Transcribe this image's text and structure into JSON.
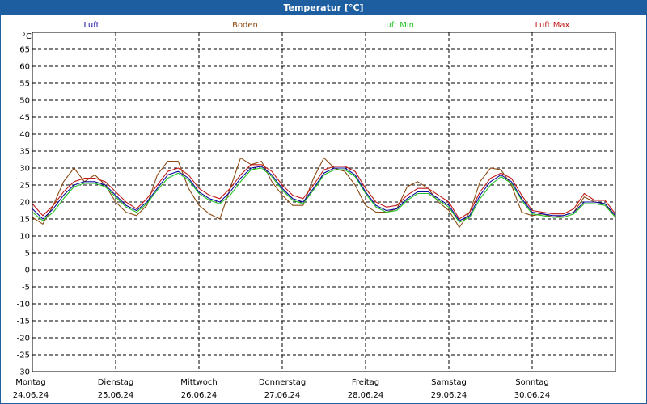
{
  "window": {
    "title": "Temperatur [°C]"
  },
  "colors": {
    "luft": "#0a0aa0",
    "boden": "#8a4a12",
    "luft_min": "#22c022",
    "luft_max": "#c01818"
  },
  "chart_data": {
    "type": "line",
    "title": "Temperatur [°C]",
    "ylabel": "°C",
    "ylim": [
      -30,
      70
    ],
    "yticks": [
      -30,
      -25,
      -20,
      -15,
      -10,
      -5,
      0,
      5,
      10,
      15,
      20,
      25,
      30,
      35,
      40,
      45,
      50,
      55,
      60,
      65
    ],
    "grid": true,
    "legend_placement": "top",
    "x_range": [
      0,
      7
    ],
    "days": [
      {
        "weekday": "Montag",
        "date": "24.06.24"
      },
      {
        "weekday": "Dienstag",
        "date": "25.06.24"
      },
      {
        "weekday": "Mittwoch",
        "date": "26.06.24"
      },
      {
        "weekday": "Donnerstag",
        "date": "27.06.24"
      },
      {
        "weekday": "Freitag",
        "date": "28.06.24"
      },
      {
        "weekday": "Samstag",
        "date": "29.06.24"
      },
      {
        "weekday": "Sonntag",
        "date": "30.06.24"
      }
    ],
    "x": [
      0,
      0.125,
      0.25,
      0.375,
      0.5,
      0.625,
      0.75,
      0.875,
      1,
      1.125,
      1.25,
      1.375,
      1.5,
      1.625,
      1.75,
      1.875,
      2,
      2.125,
      2.25,
      2.375,
      2.5,
      2.625,
      2.75,
      2.875,
      3,
      3.125,
      3.25,
      3.375,
      3.5,
      3.625,
      3.75,
      3.875,
      4,
      4.125,
      4.25,
      4.375,
      4.5,
      4.625,
      4.75,
      4.875,
      5,
      5.125,
      5.25,
      5.375,
      5.5,
      5.625,
      5.75,
      5.875,
      6,
      6.125,
      6.25,
      6.375,
      6.5,
      6.625,
      6.75,
      6.875,
      7
    ],
    "series": [
      {
        "name": "Luft",
        "key": "luft",
        "values": [
          18,
          15,
          18,
          22,
          25,
          26,
          26,
          25,
          22,
          19,
          17.5,
          20,
          24,
          28,
          29,
          27,
          23,
          21,
          20,
          23,
          27,
          30,
          30.5,
          28,
          24,
          21,
          20,
          24,
          28.5,
          30,
          30,
          28,
          23,
          19,
          17.5,
          18,
          21,
          23,
          23,
          21,
          19,
          14.5,
          16,
          22,
          26,
          28,
          26,
          21,
          17,
          16.5,
          16,
          16,
          17,
          20,
          20,
          19.5,
          16
        ]
      },
      {
        "name": "Boden",
        "key": "boden",
        "values": [
          15.5,
          13.5,
          19,
          26,
          30,
          26,
          28,
          25,
          20,
          17,
          16,
          19,
          28,
          32,
          32,
          24,
          19,
          16.5,
          15,
          24,
          33,
          31,
          32,
          26,
          22,
          19,
          19,
          27,
          33,
          30,
          29,
          25,
          19,
          17,
          17,
          18,
          24.5,
          26,
          24,
          20,
          17.5,
          12.5,
          17,
          26,
          30,
          29.5,
          25,
          17,
          16,
          16.5,
          15.5,
          16,
          17,
          21.5,
          20,
          19.5,
          15.5
        ]
      },
      {
        "name": "Luft Min",
        "key": "luft_min",
        "values": [
          17,
          14.5,
          17,
          21,
          24.5,
          25.5,
          25.5,
          24.5,
          21.5,
          18.5,
          17,
          19.5,
          23.5,
          27,
          28.5,
          26.5,
          22.5,
          20.5,
          19.5,
          22,
          26,
          29.5,
          30,
          27.5,
          23.5,
          20.5,
          19.5,
          23.5,
          28,
          29.5,
          29.5,
          27.5,
          22.5,
          18.5,
          17,
          17.5,
          20.5,
          22.5,
          22.5,
          20.5,
          18.5,
          14,
          15.5,
          21,
          25,
          27.5,
          25.5,
          20.5,
          16.5,
          16,
          15.5,
          15.5,
          16.5,
          19.5,
          19.5,
          19,
          15.5
        ]
      },
      {
        "name": "Luft Max",
        "key": "luft_max",
        "values": [
          19.5,
          16,
          19,
          23,
          26,
          27,
          27,
          26,
          23,
          20,
          18,
          21,
          25,
          29,
          30,
          28,
          24,
          22,
          21,
          24,
          28,
          31,
          31,
          29,
          25,
          22,
          21,
          25,
          29.5,
          30.5,
          30.5,
          29,
          24,
          20,
          18.5,
          19,
          22,
          24,
          24,
          22,
          20,
          15,
          17,
          23,
          27,
          28.5,
          27,
          22,
          17.5,
          17,
          16.5,
          16.5,
          18,
          22.5,
          20.5,
          20.5,
          16.5
        ]
      }
    ]
  }
}
